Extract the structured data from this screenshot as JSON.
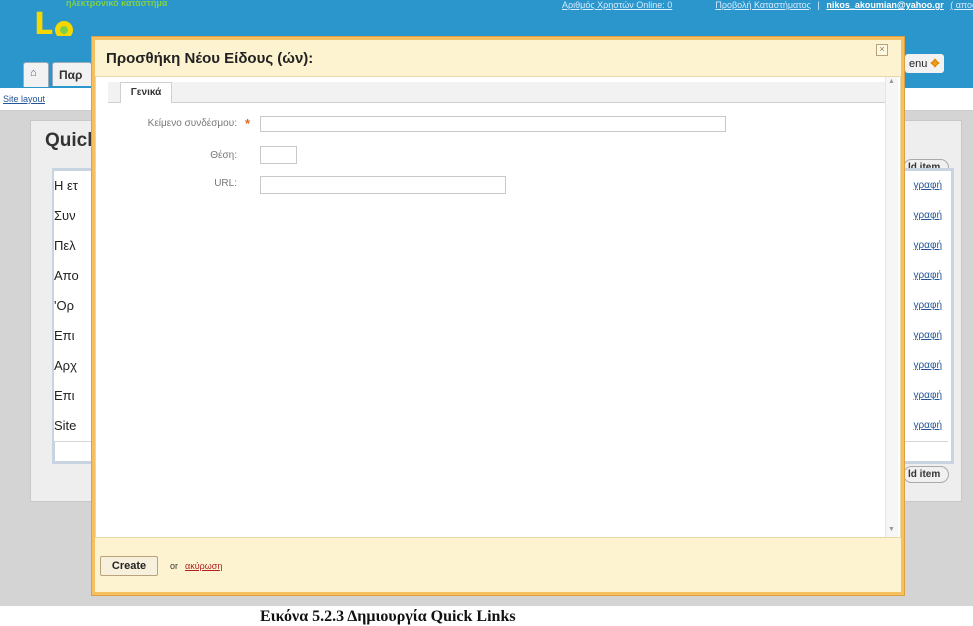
{
  "app": {
    "logo_tagline": "ηλεκτρονικό κατάστημα",
    "logo_word": "Lemonion",
    "top_links": {
      "users_online": "Αριθμός Χρηστών Online: 0",
      "separator1": "|",
      "view_store": "Προβολή Καταστήματος",
      "separator2": "|",
      "user_email": "nikos_akoumian@yahoo.gr",
      "logout": "( αποσύνδεση ▸ )"
    },
    "first_tab": "Παρ",
    "menu_tab": "enu",
    "site_layout_link": "Site layout",
    "section_title": "Quick",
    "add_item_label": "ld item",
    "rows": [
      {
        "label": "Η ετ",
        "action": "γραφή"
      },
      {
        "label": "Συν",
        "action": "γραφή"
      },
      {
        "label": "Πελ",
        "action": "γραφή"
      },
      {
        "label": "Απο",
        "action": "γραφή"
      },
      {
        "label": "'Ορ",
        "action": "γραφή"
      },
      {
        "label": "Επι",
        "action": "γραφή"
      },
      {
        "label": "Αρχ",
        "action": "γραφή"
      },
      {
        "label": "Επι",
        "action": "γραφή"
      },
      {
        "label": "Site",
        "action": "γραφή"
      }
    ]
  },
  "modal": {
    "title": "Προσθήκη Νέου Είδους (ών):",
    "close_symbol": "×",
    "tabs": [
      "Γενικά"
    ],
    "fields": [
      {
        "label": "Κείμενο συνδέσμου:",
        "required": true,
        "value": ""
      },
      {
        "label": "Θέση:",
        "required": false,
        "value": ""
      },
      {
        "label": "URL:",
        "required": false,
        "value": ""
      }
    ],
    "required_mark": "*",
    "create_label": "Create",
    "or_label": "or",
    "cancel_label": "ακύρωση"
  },
  "caption": "Εικόνα 5.2.3 Δημιουργία Quick Links",
  "colors": {
    "topbar": "#2a96cc",
    "modal_border": "#f5c060",
    "modal_header": "#fdf3d0",
    "required_star": "#e06a1a",
    "link": "#225599",
    "cancel_link": "#b02020"
  }
}
